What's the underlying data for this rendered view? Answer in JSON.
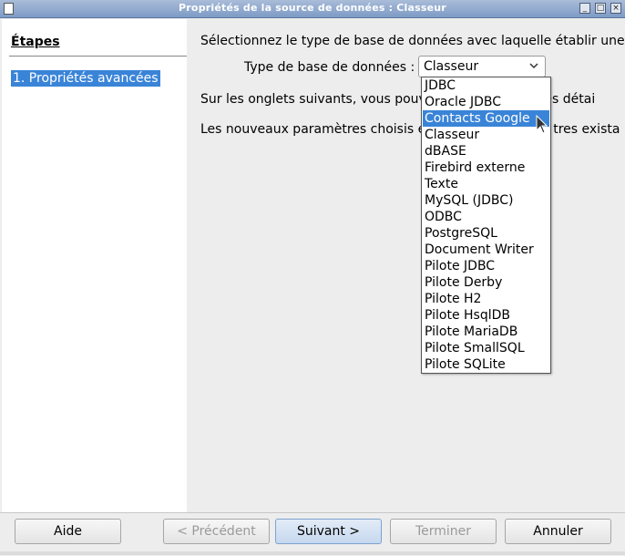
{
  "window": {
    "title": "Propriétés de la source de données : Classeur",
    "controls": {
      "minimize": "_",
      "maximize": "□",
      "close": "×"
    }
  },
  "sidebar": {
    "title": "Étapes",
    "steps": [
      {
        "label": "1. Propriétés avancées",
        "selected": true
      }
    ]
  },
  "main": {
    "intro": "Sélectionnez le type de base de données avec laquelle établir une c",
    "db_type_label": "Type de base de données :",
    "db_type_value": "Classeur",
    "para1_left": "Sur les onglets suivants, vous pouve",
    "para1_right": "tres détai",
    "para2_left": "Les nouveaux paramètres choisis é",
    "para2_right": "tres exista"
  },
  "dropdown": {
    "options": [
      "JDBC",
      "Oracle JDBC",
      "Contacts Google",
      "Classeur",
      "dBASE",
      "Firebird externe",
      "Texte",
      "MySQL (JDBC)",
      "ODBC",
      "PostgreSQL",
      "Document Writer",
      "Pilote JDBC",
      "Pilote Derby",
      "Pilote H2",
      "Pilote HsqlDB",
      "Pilote MariaDB",
      "Pilote SmallSQL",
      "Pilote SQLite"
    ],
    "highlighted": "Contacts Google"
  },
  "footer": {
    "help": "Aide",
    "previous": "< Précédent",
    "next": "Suivant >",
    "finish": "Terminer",
    "cancel": "Annuler"
  },
  "colors": {
    "accent": "#3a84d8",
    "titlebar": "#8aa5cd"
  },
  "icons": {
    "dropdown_arrow": "chevron-down-icon",
    "pointer": "mouse-cursor-icon"
  }
}
